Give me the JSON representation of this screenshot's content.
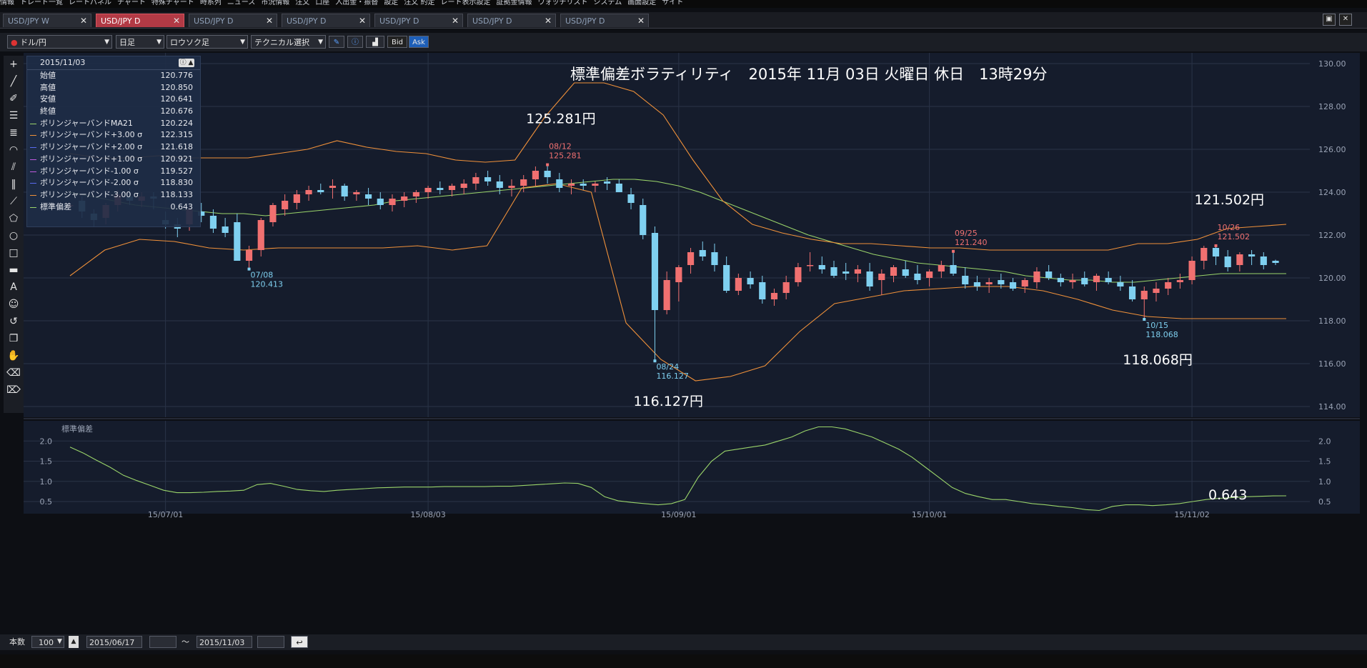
{
  "menu": [
    "情報",
    "トレード一覧",
    "レートパネル",
    "チャート",
    "特殊チャート",
    "時系列",
    "ニュース",
    "市況情報",
    "注文",
    "口座",
    "入出金・振替",
    "設定",
    "注文 約定",
    "レート表示設定",
    "証拠金情報",
    "ウォッチリスト",
    "システム",
    "画面設定",
    "サイト"
  ],
  "tabs": [
    {
      "label": "USD/JPY W",
      "active": false
    },
    {
      "label": "USD/JPY D",
      "active": true
    },
    {
      "label": "USD/JPY D",
      "active": false
    },
    {
      "label": "USD/JPY D",
      "active": false
    },
    {
      "label": "USD/JPY D",
      "active": false
    },
    {
      "label": "USD/JPY D",
      "active": false
    },
    {
      "label": "USD/JPY D",
      "active": false
    }
  ],
  "toolbar": {
    "pair": "ドル/円",
    "period": "日足",
    "chart_type": "ロウソク足",
    "technical": "テクニカル選択",
    "bid": "Bid",
    "ask": "Ask"
  },
  "info": {
    "date": "2015/11/03",
    "rows": [
      {
        "label": "始値",
        "value": "120.776",
        "color": ""
      },
      {
        "label": "高値",
        "value": "120.850",
        "color": ""
      },
      {
        "label": "安値",
        "value": "120.641",
        "color": ""
      },
      {
        "label": "終値",
        "value": "120.676",
        "color": ""
      },
      {
        "label": "ボリンジャーバンドMA21",
        "value": "120.224",
        "color": "#9ad46a"
      },
      {
        "label": "ボリンジャーバンド+3.00 σ",
        "value": "122.315",
        "color": "#f0913a"
      },
      {
        "label": "ボリンジャーバンド+2.00 σ",
        "value": "121.618",
        "color": "#5a6cf0"
      },
      {
        "label": "ボリンジャーバンド+1.00 σ",
        "value": "120.921",
        "color": "#c05ae0"
      },
      {
        "label": "ボリンジャーバンド-1.00 σ",
        "value": "119.527",
        "color": "#c05ae0"
      },
      {
        "label": "ボリンジャーバンド-2.00 σ",
        "value": "118.830",
        "color": "#5a6cf0"
      },
      {
        "label": "ボリンジャーバンド-3.00 σ",
        "value": "118.133",
        "color": "#f0913a"
      },
      {
        "label": "標準偏差",
        "value": "0.643",
        "color": "#9ad46a"
      }
    ]
  },
  "bottom": {
    "count_label": "本数",
    "count": "100",
    "from": "2015/06/17",
    "tilde": "～",
    "to": "2015/11/03"
  },
  "chart_data": {
    "type": "candlestick",
    "title": "標準偏差ボラティリティ　2015年 11月 03日 火曜日 休日　13時29分",
    "ylim": [
      113.5,
      130.5
    ],
    "yticks": [
      "114.00",
      "116.00",
      "118.00",
      "120.00",
      "122.00",
      "124.00",
      "126.00",
      "128.00",
      "130.00"
    ],
    "xticks": [
      {
        "label": "15/07/01",
        "index": 8
      },
      {
        "label": "15/08/03",
        "index": 30
      },
      {
        "label": "15/09/01",
        "index": 51
      },
      {
        "label": "15/10/01",
        "index": 72
      },
      {
        "label": "15/11/02",
        "index": 94
      }
    ],
    "candles": [
      [
        123.4,
        123.5,
        123.2,
        123.4
      ],
      [
        123.6,
        123.8,
        122.8,
        123.1
      ],
      [
        123.0,
        123.2,
        122.4,
        122.7
      ],
      [
        122.8,
        123.5,
        122.5,
        123.4
      ],
      [
        123.4,
        124.1,
        123.1,
        123.9
      ],
      [
        123.8,
        124.2,
        123.4,
        123.6
      ],
      [
        123.6,
        124.0,
        123.3,
        123.8
      ],
      [
        123.8,
        124.0,
        123.2,
        123.7
      ],
      [
        122.7,
        123.1,
        122.3,
        122.5
      ],
      [
        122.5,
        122.8,
        121.9,
        122.3
      ],
      [
        122.5,
        123.4,
        122.2,
        123.2
      ],
      [
        123.1,
        123.5,
        122.6,
        122.9
      ],
      [
        122.9,
        123.2,
        122.1,
        122.3
      ],
      [
        122.4,
        122.8,
        121.9,
        122.1
      ],
      [
        122.6,
        123.0,
        121.9,
        120.8
      ],
      [
        120.8,
        121.5,
        120.413,
        121.3
      ],
      [
        121.3,
        122.8,
        121.0,
        122.7
      ],
      [
        122.6,
        123.5,
        122.4,
        123.4
      ],
      [
        123.2,
        123.9,
        122.9,
        123.6
      ],
      [
        123.5,
        124.1,
        123.2,
        123.9
      ],
      [
        123.9,
        124.3,
        123.6,
        124.1
      ],
      [
        124.1,
        124.4,
        123.9,
        124.0
      ],
      [
        124.2,
        124.6,
        123.7,
        124.3
      ],
      [
        124.3,
        124.4,
        123.6,
        123.8
      ],
      [
        123.9,
        124.1,
        123.6,
        124.0
      ],
      [
        123.9,
        124.2,
        123.4,
        123.7
      ],
      [
        123.7,
        124.0,
        123.2,
        123.4
      ],
      [
        123.4,
        123.9,
        123.1,
        123.7
      ],
      [
        123.6,
        124.0,
        123.3,
        123.8
      ],
      [
        123.8,
        124.1,
        123.5,
        124.0
      ],
      [
        124.0,
        124.3,
        123.7,
        124.2
      ],
      [
        124.2,
        124.5,
        123.9,
        124.1
      ],
      [
        124.1,
        124.4,
        123.8,
        124.3
      ],
      [
        124.2,
        124.6,
        123.9,
        124.4
      ],
      [
        124.4,
        124.9,
        124.1,
        124.7
      ],
      [
        124.7,
        125.0,
        124.3,
        124.5
      ],
      [
        124.5,
        124.8,
        123.9,
        124.2
      ],
      [
        124.2,
        124.6,
        123.8,
        124.3
      ],
      [
        124.3,
        124.8,
        124.0,
        124.6
      ],
      [
        124.6,
        125.2,
        124.3,
        125.0
      ],
      [
        125.0,
        125.281,
        124.4,
        124.7
      ],
      [
        124.6,
        124.9,
        124.0,
        124.2
      ],
      [
        124.3,
        124.6,
        123.9,
        124.4
      ],
      [
        124.4,
        124.6,
        124.1,
        124.3
      ],
      [
        124.3,
        124.5,
        124.0,
        124.4
      ],
      [
        124.5,
        124.7,
        124.1,
        124.4
      ],
      [
        124.4,
        124.6,
        124.0,
        124.0
      ],
      [
        123.9,
        124.2,
        123.2,
        123.5
      ],
      [
        123.4,
        123.7,
        121.8,
        122.0
      ],
      [
        122.1,
        122.4,
        116.127,
        118.5
      ],
      [
        118.5,
        120.3,
        118.3,
        119.9
      ],
      [
        119.8,
        120.6,
        118.9,
        120.5
      ],
      [
        120.6,
        121.4,
        120.2,
        121.2
      ],
      [
        121.3,
        121.7,
        120.8,
        121.0
      ],
      [
        121.2,
        121.6,
        120.3,
        120.6
      ],
      [
        120.6,
        121.0,
        119.3,
        119.4
      ],
      [
        119.4,
        120.2,
        119.2,
        120.0
      ],
      [
        120.0,
        120.3,
        119.5,
        119.7
      ],
      [
        119.8,
        120.1,
        118.8,
        119.0
      ],
      [
        119.0,
        119.5,
        118.7,
        119.3
      ],
      [
        119.3,
        120.1,
        119.0,
        119.8
      ],
      [
        119.8,
        120.7,
        119.6,
        120.5
      ],
      [
        120.6,
        121.2,
        120.3,
        120.6
      ],
      [
        120.6,
        121.0,
        120.2,
        120.4
      ],
      [
        120.5,
        120.8,
        120.0,
        120.1
      ],
      [
        120.3,
        120.7,
        119.9,
        120.2
      ],
      [
        120.2,
        120.6,
        119.8,
        120.4
      ],
      [
        120.3,
        120.7,
        119.4,
        119.6
      ],
      [
        119.9,
        120.4,
        119.2,
        120.2
      ],
      [
        120.1,
        120.6,
        119.8,
        120.5
      ],
      [
        120.4,
        120.8,
        120.0,
        120.1
      ],
      [
        120.2,
        120.6,
        119.7,
        119.9
      ],
      [
        120.0,
        120.4,
        119.6,
        120.3
      ],
      [
        120.3,
        120.8,
        120.0,
        120.6
      ],
      [
        120.6,
        121.24,
        120.1,
        120.2
      ],
      [
        120.1,
        120.5,
        119.5,
        119.7
      ],
      [
        119.8,
        120.1,
        119.4,
        119.6
      ],
      [
        119.7,
        120.0,
        119.3,
        119.8
      ],
      [
        119.9,
        120.2,
        119.5,
        119.7
      ],
      [
        119.8,
        120.0,
        119.4,
        119.5
      ],
      [
        119.6,
        120.0,
        119.3,
        119.9
      ],
      [
        119.8,
        120.5,
        119.5,
        120.3
      ],
      [
        120.3,
        120.6,
        119.9,
        120.0
      ],
      [
        120.0,
        120.2,
        119.6,
        119.8
      ],
      [
        119.8,
        120.2,
        119.5,
        119.9
      ],
      [
        120.0,
        120.3,
        119.6,
        119.7
      ],
      [
        119.8,
        120.2,
        119.4,
        120.1
      ],
      [
        120.0,
        120.3,
        119.7,
        119.8
      ],
      [
        119.8,
        120.1,
        119.4,
        119.6
      ],
      [
        119.6,
        119.9,
        118.9,
        119.0
      ],
      [
        119.0,
        119.6,
        118.068,
        119.4
      ],
      [
        119.3,
        119.8,
        118.9,
        119.5
      ],
      [
        119.5,
        120.0,
        119.2,
        119.8
      ],
      [
        119.8,
        120.2,
        119.5,
        119.9
      ],
      [
        119.9,
        121.0,
        119.7,
        120.8
      ],
      [
        120.8,
        121.5,
        120.4,
        121.4
      ],
      [
        121.4,
        121.502,
        120.6,
        121.0
      ],
      [
        121.0,
        121.3,
        120.3,
        120.5
      ],
      [
        120.6,
        121.2,
        120.3,
        121.1
      ],
      [
        121.1,
        121.3,
        120.6,
        121.0
      ],
      [
        121.0,
        121.2,
        120.4,
        120.6
      ],
      [
        120.8,
        120.85,
        120.6,
        120.7
      ]
    ],
    "bands": [
      {
        "name": "MA21",
        "color": "#9ad46a",
        "values": [
          124.0,
          123.8,
          123.6,
          123.4,
          123.3,
          123.2,
          123.1,
          123.0,
          123.0,
          122.9,
          123.0,
          123.1,
          123.2,
          123.3,
          123.4,
          123.6,
          123.7,
          123.8,
          123.9,
          124.0,
          124.1,
          124.2,
          124.3,
          124.4,
          124.5,
          124.6,
          124.6,
          124.5,
          124.3,
          124.0,
          123.6,
          123.2,
          122.8,
          122.4,
          122.0,
          121.7,
          121.4,
          121.1,
          120.9,
          120.7,
          120.6,
          120.5,
          120.4,
          120.3,
          120.1,
          120.0,
          119.9,
          119.9,
          119.8,
          119.8,
          119.9,
          120.0,
          120.1,
          120.2,
          120.2,
          120.2,
          120.2
        ]
      },
      {
        "name": "+3σ",
        "color": "#f0913a",
        "values": [
          125.8,
          125.6,
          125.6,
          125.7,
          125.6,
          125.6,
          125.6,
          125.8,
          126.0,
          126.4,
          126.1,
          125.9,
          125.8,
          125.5,
          125.4,
          125.5,
          127.5,
          129.1,
          129.1,
          128.7,
          127.6,
          125.5,
          123.6,
          122.5,
          122.1,
          121.8,
          121.6,
          121.6,
          121.5,
          121.4,
          121.4,
          121.3,
          121.3,
          121.3,
          121.3,
          121.3,
          121.6,
          121.6,
          121.8,
          122.3,
          122.4,
          122.5
        ]
      },
      {
        "name": "-3σ",
        "color": "#f0913a",
        "values": [
          120.1,
          121.3,
          121.8,
          121.7,
          121.4,
          121.3,
          121.4,
          121.4,
          121.4,
          121.4,
          121.5,
          121.3,
          121.5,
          124.2,
          124.4,
          124.0,
          117.9,
          116.2,
          115.2,
          115.4,
          115.9,
          117.5,
          118.8,
          119.1,
          119.4,
          119.5,
          119.6,
          119.6,
          119.4,
          119.0,
          118.5,
          118.2,
          118.1,
          118.1,
          118.1,
          118.1
        ]
      }
    ],
    "annotations": [
      {
        "date": "08/12",
        "value": "125.281",
        "big": "125.281円",
        "kind": "high"
      },
      {
        "date": "07/08",
        "value": "120.413",
        "kind": "low"
      },
      {
        "date": "08/24",
        "value": "116.127",
        "big": "116.127円",
        "kind": "low"
      },
      {
        "date": "09/25",
        "value": "121.240",
        "kind": "high"
      },
      {
        "date": "10/15",
        "value": "118.068",
        "big": "118.068円",
        "kind": "low"
      },
      {
        "date": "10/26",
        "value": "121.502",
        "big": "121.502円",
        "kind": "high"
      }
    ],
    "sub": {
      "label": "標準偏差",
      "ylim": [
        0.2,
        2.5
      ],
      "yticks": [
        "0.5",
        "1.0",
        "1.5",
        "2.0"
      ],
      "last": "0.643",
      "values": [
        1.85,
        1.7,
        1.52,
        1.35,
        1.15,
        1.02,
        0.9,
        0.78,
        0.72,
        0.72,
        0.73,
        0.75,
        0.76,
        0.78,
        0.92,
        0.95,
        0.88,
        0.8,
        0.77,
        0.75,
        0.78,
        0.8,
        0.82,
        0.84,
        0.85,
        0.86,
        0.86,
        0.86,
        0.87,
        0.87,
        0.87,
        0.87,
        0.88,
        0.88,
        0.9,
        0.92,
        0.94,
        0.96,
        0.95,
        0.85,
        0.62,
        0.52,
        0.48,
        0.45,
        0.42,
        0.45,
        0.55,
        1.1,
        1.5,
        1.75,
        1.8,
        1.85,
        1.9,
        2.0,
        2.1,
        2.25,
        2.35,
        2.35,
        2.3,
        2.2,
        2.1,
        1.95,
        1.8,
        1.6,
        1.35,
        1.1,
        0.85,
        0.7,
        0.62,
        0.55,
        0.55,
        0.5,
        0.45,
        0.42,
        0.38,
        0.35,
        0.3,
        0.28,
        0.38,
        0.42,
        0.42,
        0.4,
        0.42,
        0.45,
        0.5,
        0.55,
        0.58,
        0.6,
        0.62,
        0.63,
        0.64,
        0.643
      ]
    }
  }
}
